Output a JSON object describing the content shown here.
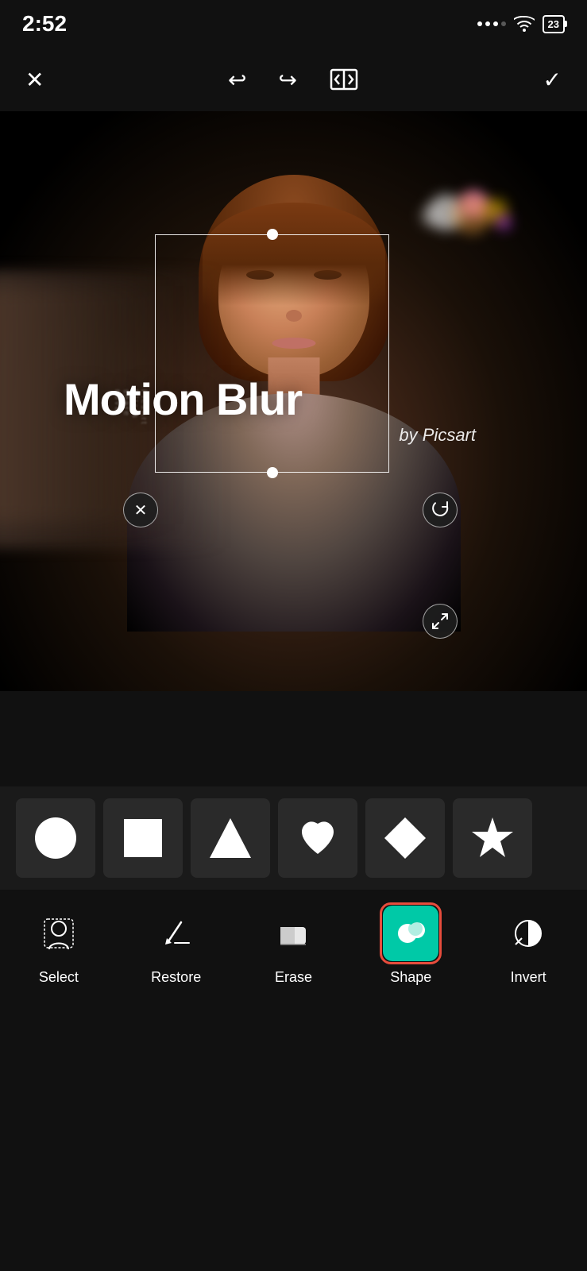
{
  "statusBar": {
    "time": "2:52",
    "battery": "23"
  },
  "toolbar": {
    "closeLabel": "✕",
    "undoLabel": "↩",
    "redoLabel": "↪",
    "compareLabel": "⊟",
    "confirmLabel": "✓"
  },
  "canvas": {
    "motionBlurText": "Motion Blur",
    "byPicsartText": "by Picsart"
  },
  "shapes": [
    {
      "name": "circle",
      "label": "Circle"
    },
    {
      "name": "square",
      "label": "Square"
    },
    {
      "name": "triangle",
      "label": "Triangle"
    },
    {
      "name": "heart",
      "label": "Heart"
    },
    {
      "name": "diamond",
      "label": "Diamond"
    },
    {
      "name": "star",
      "label": "Star"
    }
  ],
  "tools": [
    {
      "id": "select",
      "label": "Select",
      "active": false
    },
    {
      "id": "restore",
      "label": "Restore",
      "active": false
    },
    {
      "id": "erase",
      "label": "Erase",
      "active": false
    },
    {
      "id": "shape",
      "label": "Shape",
      "active": true
    },
    {
      "id": "invert",
      "label": "Invert",
      "active": false
    }
  ],
  "colors": {
    "accent": "#00c9a7",
    "activeBorder": "#e74c3c",
    "bg": "#111111",
    "panelBg": "#1a1a1a"
  }
}
